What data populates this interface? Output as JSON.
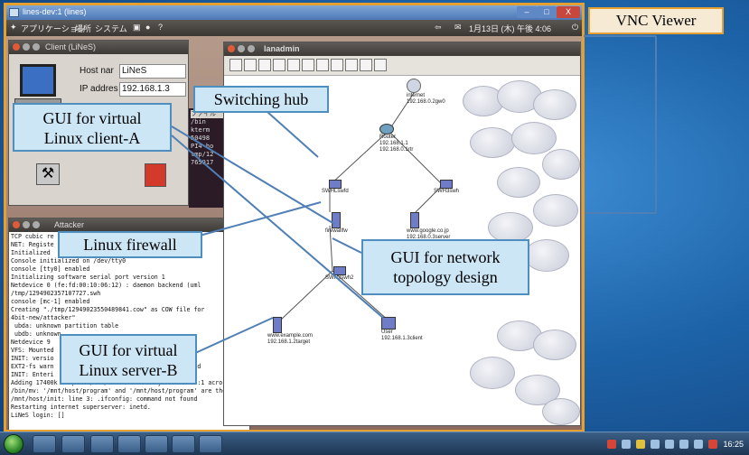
{
  "vnc": {
    "title": "lines-dev:1 (lines)",
    "label": "VNC Viewer",
    "controls": {
      "min": "–",
      "max": "□",
      "close": "X"
    }
  },
  "ubuntu_panel": {
    "menus": [
      "アプリケーション",
      "場所",
      "システム"
    ],
    "clock": "1月13日 (木) 午後 4:06"
  },
  "client": {
    "title": "Client (LiNeS)",
    "host_label": "Host nar",
    "host_value": "LiNeS",
    "ip_label": "IP addres",
    "ip_value": "192.168.1.3"
  },
  "terminal_small": {
    "menu": "ファイル",
    "lines": [
      "/bin",
      "kterm",
      "50498",
      "PI4 ho",
      "tmp/12",
      "765917"
    ]
  },
  "attacker": {
    "title": "Attacker",
    "lines": [
      "TCP cubic re",
      "NET: Registe",
      "Initialized",
      "Console initialized on /dev/tty0",
      "console [tty0] enabled",
      "Initializing software serial port version 1",
      "Netdevice 0 (fe:fd:00:10:06:12) : daemon backend (uml",
      "/tmp/1294902357107727.swh",
      "console [mc-1] enabled",
      "Creating \"./tmp/12949023550489841.cow\" as COW file for",
      "4bit-new/attacker\"",
      " ubda: unknown partition table",
      " ubdb: unknown",
      "Netdevice 9                                       nd",
      "VFS: Mounted",
      "INIT: versio",
      "EXT2-fs warn                      fsck is recommended",
      "INIT: Enteri",
      "Adding 17400k swap on /dev/ubdb.  Priority:1 extents:1 across:17400k",
      "/bin/mv: '/mnt/host/program' and '/mnt/host/program' are the same file",
      "/mnt/host/init: line 3: .ifconfig: command not found",
      "Restarting internet superserver: inetd.",
      "",
      "LiNeS login: []"
    ]
  },
  "lanadmin": {
    "title": "lanadmin",
    "nodes": {
      "internet": {
        "name": "internet",
        "ip": "192.168.0.2gw0"
      },
      "router": {
        "name": "Router",
        "ip1": "192.168.1.1",
        "ip2": "192.168.0.1rtr"
      },
      "sw_fw": {
        "name": "SWHLswfd"
      },
      "sw_lan": {
        "name": "SWH3swh"
      },
      "firewall": {
        "name": "firewallfw"
      },
      "google": {
        "name": "www.google.co.jp",
        "ip": "192.168.0.3server"
      },
      "sw_target": {
        "name": "SWH2swh2"
      },
      "example": {
        "name": "www.example.com",
        "ip": "192.168.1.2target"
      },
      "user": {
        "name": "User",
        "ip": "192.168.1.3client"
      }
    }
  },
  "callouts": {
    "switching_hub": "Switching hub",
    "gui_client": [
      "GUI for virtual",
      "Linux client-A"
    ],
    "linux_firewall": "Linux firewall",
    "gui_network": [
      "GUI for network",
      "topology design"
    ],
    "gui_server": [
      "GUI for virtual",
      "Linux server-B"
    ]
  },
  "taskbar": {
    "clock": "16:25"
  },
  "colors": {
    "callout_bg": "#cce6f6",
    "callout_border": "#4f8fbf",
    "vnc_border": "#e6a030",
    "desktop": "#1d63a8"
  }
}
